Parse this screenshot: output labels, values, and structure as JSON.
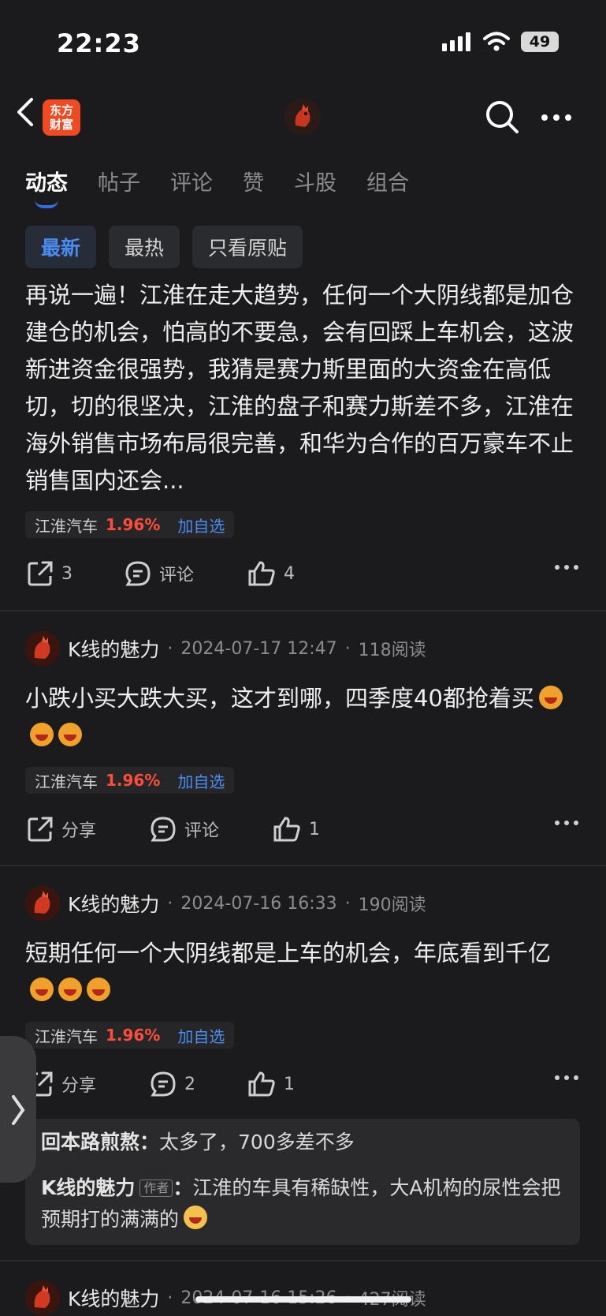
{
  "status_bar": {
    "time": "22:23",
    "battery": "49"
  },
  "nav": {
    "brand_line1": "东方",
    "brand_line2": "财富"
  },
  "tabs": [
    "动态",
    "帖子",
    "评论",
    "赞",
    "斗股",
    "组合"
  ],
  "filters": [
    "最新",
    "最热",
    "只看原贴"
  ],
  "stock": {
    "name": "江淮汽车",
    "pct": "1.96%",
    "add": "加自选"
  },
  "posts": [
    {
      "text": "再说一遍！江淮在走大趋势，任何一个大阴线都是加仓建仓的机会，怕高的不要急，会有回踩上车机会，这波新进资金很强势，我猜是赛力斯里面的大资金在高低切，切的很坚决，江淮的盘子和赛力斯差不多，江淮在海外销售市场布局很完善，和华为合作的百万豪车不止销售国内还会...",
      "share": "3",
      "comment": "评论",
      "like": "4"
    },
    {
      "author": "K线的魅力",
      "date": "2024-07-17 12:47",
      "reads": "118阅读",
      "text": "小跌小买大跌大买，这才到哪，四季度40都抢着买",
      "share": "分享",
      "comment": "评论",
      "like": "1"
    },
    {
      "author": "K线的魅力",
      "date": "2024-07-16 16:33",
      "reads": "190阅读",
      "text": "短期任何一个大阴线都是上车的机会，年底看到千亿",
      "share": "分享",
      "comment": "2",
      "like": "1",
      "replies": [
        {
          "name": "回本路煎熬",
          "text": "太多了，700多差不多"
        },
        {
          "name": "K线的魅力",
          "badge": "作者",
          "text": "江淮的车具有稀缺性，大A机构的尿性会把预期打的满满的"
        }
      ]
    },
    {
      "author": "K线的魅力",
      "date": "2024-07-16 15:26",
      "reads": "427阅读"
    }
  ],
  "colors": {
    "accent_blue": "#2f6fe0",
    "stock_red": "#ff4d3a",
    "brand_orange": "#ef4a22"
  },
  "icons": [
    "back-icon",
    "search-icon",
    "more-icon",
    "share-icon",
    "comment-icon",
    "like-icon",
    "chevron-right-icon"
  ]
}
